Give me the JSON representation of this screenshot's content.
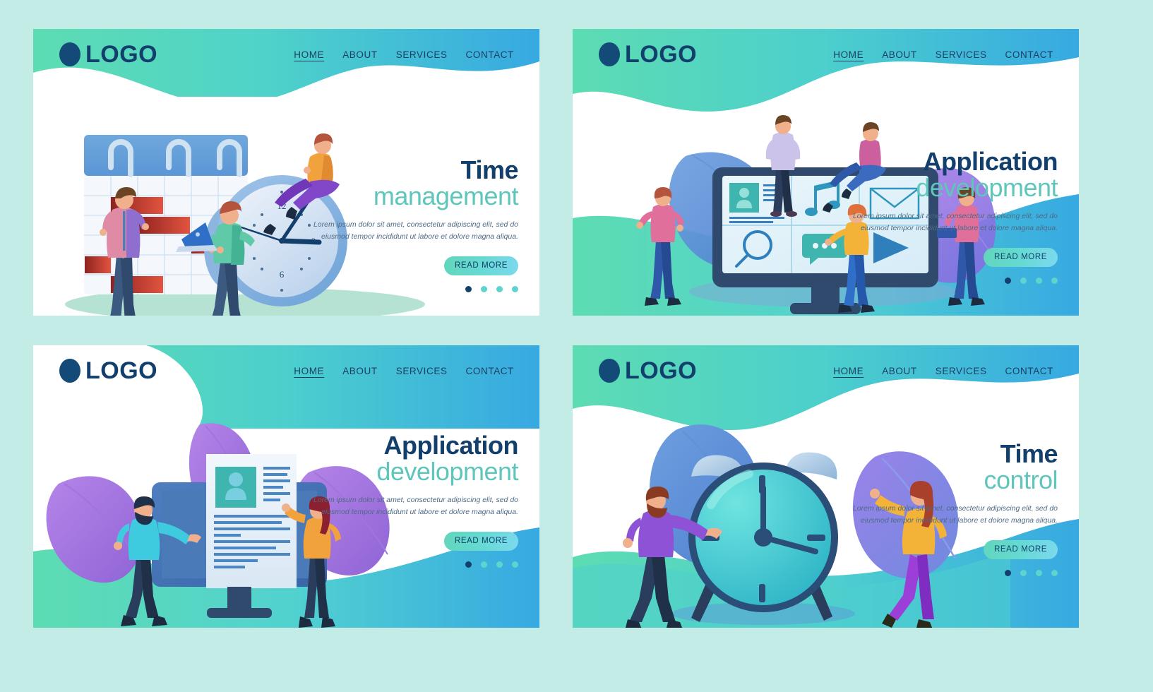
{
  "page": {
    "background_color": "#c3ece6",
    "panel_count": 4
  },
  "brand": {
    "logo_text": "LOGO",
    "logo_dot_color": "#134a78",
    "logo_text_color": "#123f6b"
  },
  "nav": {
    "items": [
      {
        "label": "HOME",
        "active": true
      },
      {
        "label": "ABOUT",
        "active": false
      },
      {
        "label": "SERVICES",
        "active": false
      },
      {
        "label": "CONTACT",
        "active": false
      }
    ]
  },
  "common": {
    "body_text": "Lorem ipsum dolor sit amet, consectetur adipiscing elit, sed do eiusmod tempor incididunt ut labore et dolore magna aliqua.",
    "read_more_label": "READ MORE",
    "pagination": {
      "total": 4,
      "active_index": 0
    },
    "heading_color_primary": "#123f6b",
    "heading_color_secondary": "#5ec6ba",
    "button_gradient_from": "#62d6bb",
    "button_gradient_to": "#7cd9ee"
  },
  "panels": [
    {
      "id": "panel-1",
      "title_line1": "Time",
      "title_line2": "management",
      "illustration": "calendar-clock-team",
      "clock_numbers": [
        "12",
        "3",
        "6",
        "9"
      ],
      "header_gradient_from": "#5ddcb2",
      "header_gradient_to": "#37a9e2"
    },
    {
      "id": "panel-2",
      "title_line1": "Application",
      "title_line2": "development",
      "illustration": "monitor-app-icons-team",
      "app_icons": [
        "profile-card-icon",
        "music-note-icon",
        "envelope-icon",
        "magnifier-icon",
        "chat-bubble-icon",
        "play-icon"
      ],
      "header_gradient_from": "#5ddcb2",
      "header_gradient_to": "#37a9e2"
    },
    {
      "id": "panel-3",
      "title_line1": "Application",
      "title_line2": "development",
      "illustration": "monitor-resume-team",
      "header_gradient_from": "#5ddcb2",
      "header_gradient_to": "#37a9e2"
    },
    {
      "id": "panel-4",
      "title_line1": "Time",
      "title_line2": "control",
      "illustration": "alarm-clock-team",
      "header_gradient_from": "#5ddcb2",
      "header_gradient_to": "#37a9e2"
    }
  ]
}
